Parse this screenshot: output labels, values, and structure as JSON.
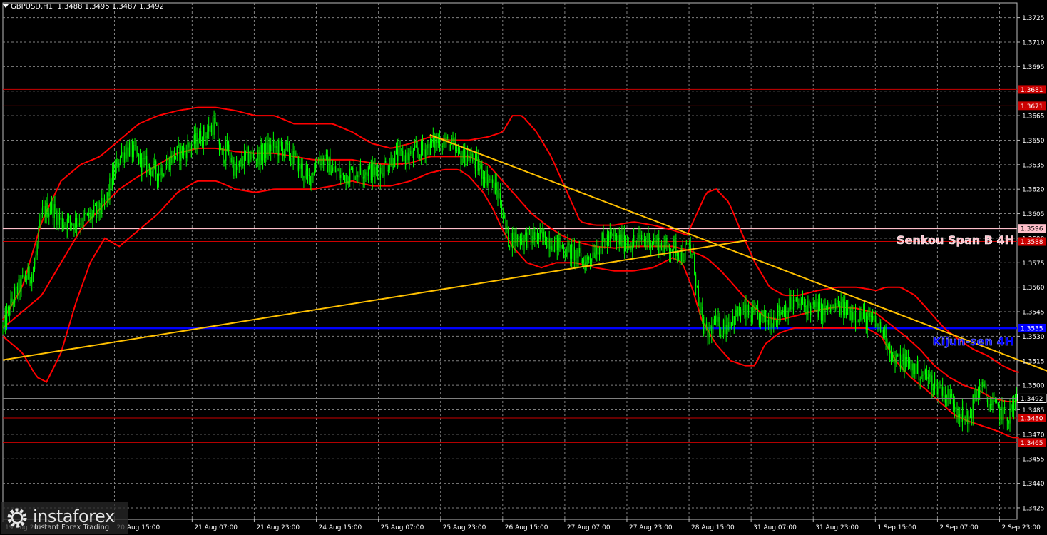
{
  "header": {
    "symbol": "GBPUSD,H1",
    "ohlc": "1.3488 1.3495 1.3487 1.3492"
  },
  "logo": {
    "brand": "instaforex",
    "tagline": "Instant Forex Trading"
  },
  "colors": {
    "background": "#000000",
    "grid": "#808080",
    "candles": "#00ff00",
    "bollinger": "#ff0000",
    "trendline": "#ffc000",
    "level_lines": "#cc0000",
    "senkou_span_b": "#ffc0cb",
    "kijun_sen": "#0000ff",
    "axis_text": "#ffffff"
  },
  "chart_data": {
    "type": "candlestick",
    "symbol": "GBPUSD",
    "timeframe": "H1",
    "y_axis": {
      "min": 1.3418,
      "max": 1.3734,
      "ticks": [
        "1.3725",
        "1.3710",
        "1.3695",
        "1.3680",
        "1.3665",
        "1.3650",
        "1.3635",
        "1.3620",
        "1.3605",
        "1.3590",
        "1.3575",
        "1.3560",
        "1.3545",
        "1.3530",
        "1.3515",
        "1.3500",
        "1.3485",
        "1.3470",
        "1.3455",
        "1.3440",
        "1.3425"
      ]
    },
    "x_axis": {
      "bar_count": 1045,
      "labels": [
        {
          "bar": 0,
          "text": "19 Aug 2025"
        },
        {
          "bar": 115,
          "text": "20 Aug 15:00"
        },
        {
          "bar": 195,
          "text": "21 Aug 07:00"
        },
        {
          "bar": 259,
          "text": "21 Aug 23:00"
        },
        {
          "bar": 323,
          "text": "24 Aug 15:00"
        },
        {
          "bar": 387,
          "text": "25 Aug 07:00"
        },
        {
          "bar": 451,
          "text": "25 Aug 23:00"
        },
        {
          "bar": 515,
          "text": "26 Aug 15:00"
        },
        {
          "bar": 579,
          "text": "27 Aug 07:00"
        },
        {
          "bar": 643,
          "text": "27 Aug 23:00"
        },
        {
          "bar": 707,
          "text": "28 Aug 15:00"
        },
        {
          "bar": 771,
          "text": "31 Aug 07:00"
        },
        {
          "bar": 835,
          "text": "31 Aug 23:00"
        },
        {
          "bar": 899,
          "text": "1 Sep 15:00"
        },
        {
          "bar": 963,
          "text": "2 Sep 07:00"
        },
        {
          "bar": 1027,
          "text": "2 Sep 23:00"
        }
      ]
    },
    "current_price": 1.3492,
    "price_path": [
      [
        0,
        1.3535
      ],
      [
        12,
        1.3555
      ],
      [
        22,
        1.3565
      ],
      [
        32,
        1.357
      ],
      [
        40,
        1.3605
      ],
      [
        50,
        1.361
      ],
      [
        60,
        1.36
      ],
      [
        75,
        1.36
      ],
      [
        90,
        1.3603
      ],
      [
        105,
        1.361
      ],
      [
        112,
        1.3625
      ],
      [
        120,
        1.364
      ],
      [
        130,
        1.3645
      ],
      [
        145,
        1.3635
      ],
      [
        160,
        1.363
      ],
      [
        175,
        1.364
      ],
      [
        190,
        1.3645
      ],
      [
        200,
        1.365
      ],
      [
        210,
        1.3655
      ],
      [
        218,
        1.366
      ],
      [
        225,
        1.364
      ],
      [
        232,
        1.3645
      ],
      [
        240,
        1.363
      ],
      [
        250,
        1.364
      ],
      [
        262,
        1.364
      ],
      [
        275,
        1.3645
      ],
      [
        290,
        1.3645
      ],
      [
        305,
        1.3635
      ],
      [
        315,
        1.3625
      ],
      [
        325,
        1.364
      ],
      [
        335,
        1.3635
      ],
      [
        348,
        1.3628
      ],
      [
        360,
        1.363
      ],
      [
        372,
        1.3632
      ],
      [
        385,
        1.363
      ],
      [
        395,
        1.3635
      ],
      [
        405,
        1.364
      ],
      [
        420,
        1.364
      ],
      [
        435,
        1.3645
      ],
      [
        450,
        1.365
      ],
      [
        460,
        1.3648
      ],
      [
        470,
        1.364
      ],
      [
        480,
        1.364
      ],
      [
        492,
        1.3632
      ],
      [
        502,
        1.3625
      ],
      [
        512,
        1.3615
      ],
      [
        520,
        1.359
      ],
      [
        530,
        1.359
      ],
      [
        545,
        1.359
      ],
      [
        560,
        1.359
      ],
      [
        575,
        1.3585
      ],
      [
        590,
        1.358
      ],
      [
        600,
        1.3575
      ],
      [
        612,
        1.3585
      ],
      [
        625,
        1.359
      ],
      [
        640,
        1.3588
      ],
      [
        655,
        1.3588
      ],
      [
        668,
        1.359
      ],
      [
        678,
        1.3585
      ],
      [
        690,
        1.3585
      ],
      [
        700,
        1.358
      ],
      [
        707,
        1.3585
      ],
      [
        712,
        1.3575
      ],
      [
        718,
        1.3545
      ],
      [
        725,
        1.353
      ],
      [
        732,
        1.3538
      ],
      [
        740,
        1.3535
      ],
      [
        750,
        1.354
      ],
      [
        760,
        1.3545
      ],
      [
        775,
        1.3542
      ],
      [
        790,
        1.354
      ],
      [
        800,
        1.3545
      ],
      [
        815,
        1.355
      ],
      [
        830,
        1.3548
      ],
      [
        845,
        1.3545
      ],
      [
        860,
        1.3548
      ],
      [
        875,
        1.3545
      ],
      [
        890,
        1.354
      ],
      [
        900,
        1.3538
      ],
      [
        910,
        1.353
      ],
      [
        918,
        1.3515
      ],
      [
        928,
        1.3515
      ],
      [
        940,
        1.351
      ],
      [
        952,
        1.3505
      ],
      [
        962,
        1.35
      ],
      [
        970,
        1.3495
      ],
      [
        980,
        1.349
      ],
      [
        990,
        1.348
      ],
      [
        995,
        1.3478
      ],
      [
        1000,
        1.349
      ],
      [
        1008,
        1.35
      ],
      [
        1015,
        1.349
      ],
      [
        1025,
        1.3485
      ],
      [
        1035,
        1.348
      ],
      [
        1045,
        1.3492
      ]
    ],
    "bollinger_upper": [
      [
        0,
        1.354
      ],
      [
        20,
        1.356
      ],
      [
        40,
        1.36
      ],
      [
        60,
        1.3625
      ],
      [
        80,
        1.3635
      ],
      [
        100,
        1.364
      ],
      [
        120,
        1.365
      ],
      [
        140,
        1.366
      ],
      [
        160,
        1.3665
      ],
      [
        180,
        1.3668
      ],
      [
        200,
        1.367
      ],
      [
        220,
        1.367
      ],
      [
        240,
        1.3668
      ],
      [
        260,
        1.3665
      ],
      [
        280,
        1.3665
      ],
      [
        300,
        1.366
      ],
      [
        320,
        1.366
      ],
      [
        340,
        1.366
      ],
      [
        360,
        1.3655
      ],
      [
        380,
        1.3648
      ],
      [
        400,
        1.3645
      ],
      [
        420,
        1.3648
      ],
      [
        440,
        1.3652
      ],
      [
        460,
        1.365
      ],
      [
        480,
        1.365
      ],
      [
        500,
        1.3652
      ],
      [
        515,
        1.3655
      ],
      [
        525,
        1.3665
      ],
      [
        535,
        1.3665
      ],
      [
        550,
        1.3655
      ],
      [
        565,
        1.364
      ],
      [
        580,
        1.362
      ],
      [
        595,
        1.36
      ],
      [
        610,
        1.3598
      ],
      [
        630,
        1.3598
      ],
      [
        650,
        1.36
      ],
      [
        670,
        1.3598
      ],
      [
        690,
        1.3595
      ],
      [
        705,
        1.3592
      ],
      [
        715,
        1.3605
      ],
      [
        725,
        1.3618
      ],
      [
        735,
        1.362
      ],
      [
        748,
        1.3612
      ],
      [
        760,
        1.3595
      ],
      [
        775,
        1.3575
      ],
      [
        790,
        1.356
      ],
      [
        805,
        1.3555
      ],
      [
        820,
        1.3555
      ],
      [
        840,
        1.3558
      ],
      [
        860,
        1.356
      ],
      [
        880,
        1.356
      ],
      [
        900,
        1.3558
      ],
      [
        910,
        1.356
      ],
      [
        925,
        1.356
      ],
      [
        940,
        1.3555
      ],
      [
        955,
        1.3545
      ],
      [
        970,
        1.3535
      ],
      [
        985,
        1.3528
      ],
      [
        1000,
        1.3522
      ],
      [
        1015,
        1.3518
      ],
      [
        1030,
        1.3512
      ],
      [
        1045,
        1.3508
      ]
    ],
    "bollinger_lower": [
      [
        0,
        1.353
      ],
      [
        20,
        1.352
      ],
      [
        35,
        1.3505
      ],
      [
        45,
        1.3502
      ],
      [
        60,
        1.352
      ],
      [
        75,
        1.355
      ],
      [
        90,
        1.3575
      ],
      [
        105,
        1.359
      ],
      [
        120,
        1.3585
      ],
      [
        140,
        1.3595
      ],
      [
        160,
        1.3605
      ],
      [
        180,
        1.3618
      ],
      [
        200,
        1.3625
      ],
      [
        220,
        1.3625
      ],
      [
        240,
        1.362
      ],
      [
        260,
        1.3618
      ],
      [
        280,
        1.362
      ],
      [
        300,
        1.362
      ],
      [
        320,
        1.362
      ],
      [
        340,
        1.3622
      ],
      [
        360,
        1.3625
      ],
      [
        380,
        1.3622
      ],
      [
        400,
        1.3622
      ],
      [
        420,
        1.3625
      ],
      [
        440,
        1.363
      ],
      [
        455,
        1.3632
      ],
      [
        470,
        1.3632
      ],
      [
        480,
        1.3628
      ],
      [
        495,
        1.3618
      ],
      [
        505,
        1.3608
      ],
      [
        515,
        1.3595
      ],
      [
        525,
        1.3585
      ],
      [
        540,
        1.3575
      ],
      [
        555,
        1.3572
      ],
      [
        570,
        1.3575
      ],
      [
        590,
        1.3575
      ],
      [
        610,
        1.3572
      ],
      [
        630,
        1.357
      ],
      [
        650,
        1.357
      ],
      [
        670,
        1.3572
      ],
      [
        690,
        1.3578
      ],
      [
        700,
        1.3575
      ],
      [
        710,
        1.356
      ],
      [
        720,
        1.354
      ],
      [
        735,
        1.3525
      ],
      [
        750,
        1.3515
      ],
      [
        765,
        1.3512
      ],
      [
        775,
        1.3512
      ],
      [
        785,
        1.3525
      ],
      [
        800,
        1.3532
      ],
      [
        815,
        1.3535
      ],
      [
        830,
        1.3535
      ],
      [
        850,
        1.3535
      ],
      [
        870,
        1.3535
      ],
      [
        890,
        1.3535
      ],
      [
        905,
        1.353
      ],
      [
        920,
        1.3515
      ],
      [
        935,
        1.3505
      ],
      [
        950,
        1.3498
      ],
      [
        965,
        1.349
      ],
      [
        980,
        1.3482
      ],
      [
        995,
        1.3478
      ],
      [
        1010,
        1.3475
      ],
      [
        1025,
        1.3472
      ],
      [
        1040,
        1.3468
      ],
      [
        1048,
        1.3468
      ]
    ],
    "bollinger_middle": [
      [
        0,
        1.3535
      ],
      [
        20,
        1.3545
      ],
      [
        40,
        1.3555
      ],
      [
        60,
        1.3575
      ],
      [
        80,
        1.3595
      ],
      [
        100,
        1.3608
      ],
      [
        120,
        1.362
      ],
      [
        140,
        1.3628
      ],
      [
        160,
        1.3635
      ],
      [
        180,
        1.3642
      ],
      [
        200,
        1.3645
      ],
      [
        220,
        1.3645
      ],
      [
        240,
        1.3643
      ],
      [
        260,
        1.3642
      ],
      [
        280,
        1.3642
      ],
      [
        300,
        1.364
      ],
      [
        320,
        1.3638
      ],
      [
        340,
        1.3638
      ],
      [
        360,
        1.3638
      ],
      [
        380,
        1.3636
      ],
      [
        400,
        1.3635
      ],
      [
        420,
        1.3636
      ],
      [
        440,
        1.364
      ],
      [
        460,
        1.364
      ],
      [
        480,
        1.364
      ],
      [
        500,
        1.3635
      ],
      [
        515,
        1.3625
      ],
      [
        530,
        1.3615
      ],
      [
        545,
        1.3605
      ],
      [
        560,
        1.3598
      ],
      [
        575,
        1.3592
      ],
      [
        590,
        1.3588
      ],
      [
        610,
        1.3585
      ],
      [
        630,
        1.3584
      ],
      [
        650,
        1.3585
      ],
      [
        670,
        1.3585
      ],
      [
        690,
        1.3585
      ],
      [
        710,
        1.3582
      ],
      [
        725,
        1.3578
      ],
      [
        740,
        1.357
      ],
      [
        755,
        1.356
      ],
      [
        770,
        1.355
      ],
      [
        785,
        1.3542
      ],
      [
        800,
        1.354
      ],
      [
        820,
        1.3543
      ],
      [
        840,
        1.3546
      ],
      [
        860,
        1.3548
      ],
      [
        880,
        1.3547
      ],
      [
        900,
        1.3544
      ],
      [
        915,
        1.3537
      ],
      [
        930,
        1.353
      ],
      [
        945,
        1.3522
      ],
      [
        960,
        1.3512
      ],
      [
        975,
        1.3505
      ],
      [
        990,
        1.35
      ],
      [
        1005,
        1.3497
      ],
      [
        1020,
        1.3492
      ],
      [
        1035,
        1.349
      ],
      [
        1048,
        1.349
      ]
    ],
    "trendlines": [
      {
        "from": [
          0,
          1.35155
        ],
        "to": [
          767,
          1.35887
        ]
      },
      {
        "from": [
          440,
          1.36533
        ],
        "to": [
          1121,
          1.34986
        ]
      }
    ],
    "levels": [
      {
        "value": 1.3681,
        "label": "1.3681",
        "kind": "support_resistance"
      },
      {
        "value": 1.3671,
        "label": "1.3671",
        "kind": "support_resistance"
      },
      {
        "value": 1.3596,
        "label": "1.3596",
        "kind": "senkou_span_b",
        "title": "Senkou Span B 4H"
      },
      {
        "value": 1.3588,
        "label": "1.3588",
        "kind": "support_resistance"
      },
      {
        "value": 1.3535,
        "label": "1.3535",
        "kind": "kijun_sen",
        "title": "Kijun-sen 4H"
      },
      {
        "value": 1.348,
        "label": "1.3480",
        "kind": "support_resistance"
      },
      {
        "value": 1.3465,
        "label": "1.3465",
        "kind": "support_resistance"
      }
    ],
    "grid": true
  }
}
